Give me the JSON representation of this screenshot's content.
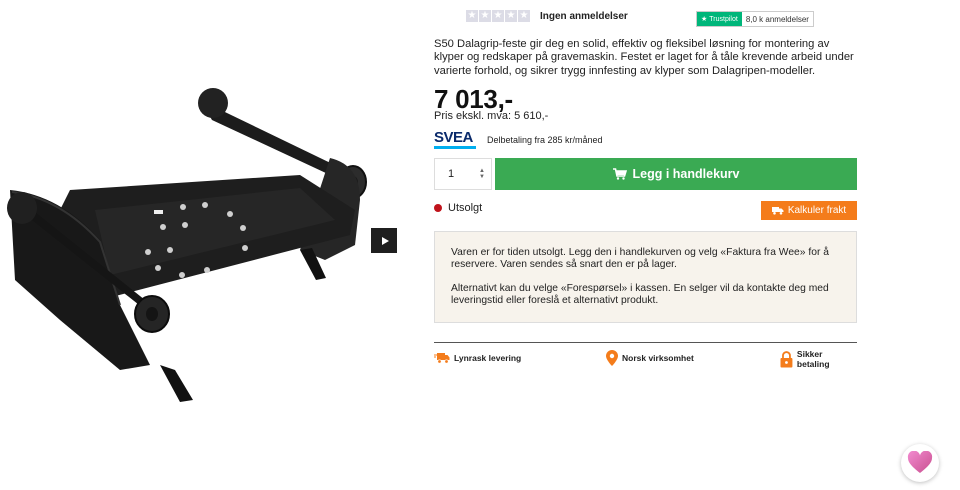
{
  "rating": {
    "stars": 5,
    "label": "Ingen anmeldelser"
  },
  "trustpilot": {
    "brand": "Trustpilot",
    "count": "8,0 k anmeldelser"
  },
  "product": {
    "description": "S50 Dalagrip-feste gir deg en solid, effektiv og fleksibel løsning for montering av klyper og redskaper på gravemaskin. Festet er laget for å tåle krevende arbeid under varierte forhold, og sikrer trygg innfesting av klyper som Dalagripen-modeller.",
    "price": "7 013,-",
    "price_ex_vat": "Pris ekskl. mva: 5 610,-"
  },
  "financing": {
    "logo_text": "SVEA",
    "text": "Delbetaling fra 285 kr/måned"
  },
  "purchase": {
    "quantity": "1",
    "add_to_cart_label": "Legg i handlekurv"
  },
  "stock": {
    "status_label": "Utsolgt",
    "status_color": "#c0131b",
    "freight_label": "Kalkuler frakt"
  },
  "notice": {
    "paragraph1": "Varen er for tiden utsolgt. Legg den i handlekurven og velg «Faktura fra Wee» for å reservere. Varen sendes så snart den er på lager.",
    "paragraph2": "Alternativt kan du velge «Forespørsel» i kassen. En selger vil da kontakte deg med leveringstid eller foreslå et alternativt produkt."
  },
  "usps": [
    {
      "label": "Lynrask levering",
      "icon": "truck-icon"
    },
    {
      "label": "Norsk virksomhet",
      "icon": "location-pin-icon"
    },
    {
      "label": "Sikker betaling",
      "icon": "lock-icon"
    }
  ],
  "colors": {
    "accent_green": "#3aaa53",
    "accent_orange": "#f47c1b",
    "trustpilot_green": "#00b67a",
    "svea_navy": "#0a2a6b"
  }
}
